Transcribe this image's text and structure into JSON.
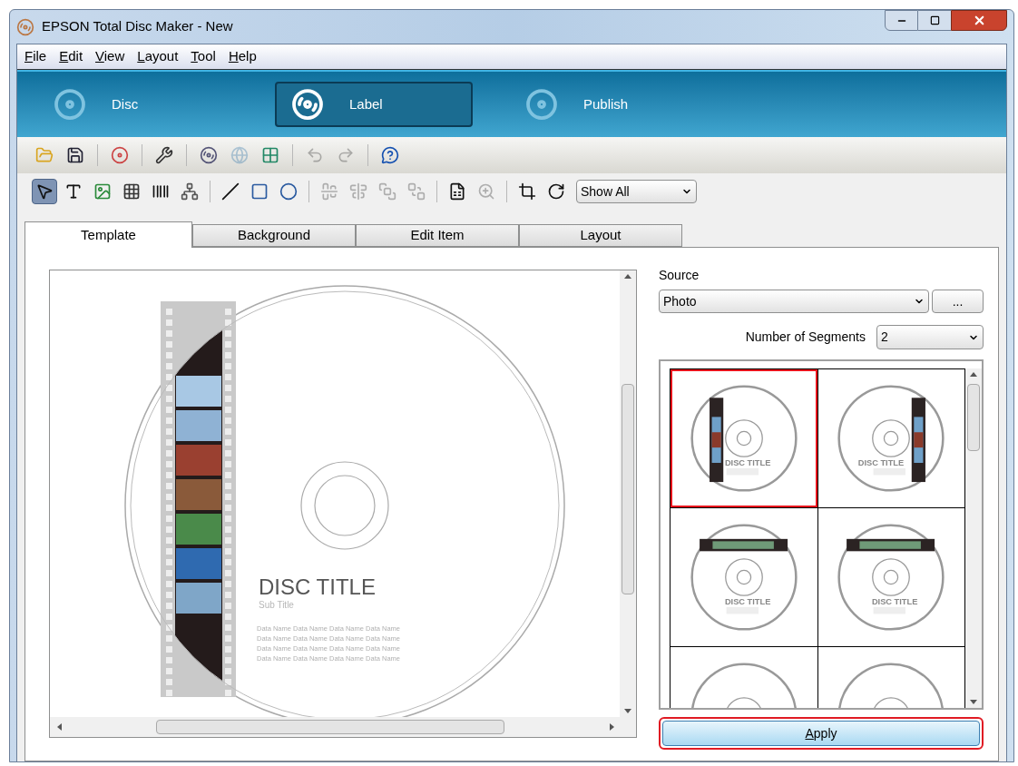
{
  "window": {
    "title": "EPSON Total Disc Maker - New"
  },
  "menu": [
    "File",
    "Edit",
    "View",
    "Layout",
    "Tool",
    "Help"
  ],
  "modes": [
    {
      "label": "Disc",
      "kind": "disc",
      "selected": false
    },
    {
      "label": "Label",
      "kind": "label",
      "selected": true
    },
    {
      "label": "Publish",
      "kind": "publish",
      "selected": false
    }
  ],
  "toolbar_1": [
    {
      "kind": "open",
      "disabled": false
    },
    {
      "kind": "save",
      "disabled": false
    },
    {
      "kind": "separator"
    },
    {
      "kind": "disc-add",
      "disabled": false
    },
    {
      "kind": "separator"
    },
    {
      "kind": "wrench",
      "disabled": false
    },
    {
      "kind": "separator"
    },
    {
      "kind": "disc-import",
      "disabled": false
    },
    {
      "kind": "globe",
      "disabled": true
    },
    {
      "kind": "grid-import",
      "disabled": false
    },
    {
      "kind": "separator"
    },
    {
      "kind": "undo",
      "disabled": true
    },
    {
      "kind": "redo",
      "disabled": true
    },
    {
      "kind": "separator"
    },
    {
      "kind": "help",
      "disabled": false
    }
  ],
  "toolbar_2": [
    {
      "kind": "pointer",
      "disabled": false,
      "selected": true
    },
    {
      "kind": "text",
      "disabled": false,
      "selected": false
    },
    {
      "kind": "image",
      "disabled": false,
      "selected": false
    },
    {
      "kind": "grid",
      "disabled": false,
      "selected": false
    },
    {
      "kind": "barcode",
      "disabled": false,
      "selected": false
    },
    {
      "kind": "tree",
      "disabled": false,
      "selected": false
    },
    {
      "kind": "separator"
    },
    {
      "kind": "line",
      "disabled": false,
      "selected": false
    },
    {
      "kind": "rectangle",
      "disabled": false,
      "selected": false
    },
    {
      "kind": "ellipse",
      "disabled": false,
      "selected": false
    },
    {
      "kind": "separator"
    },
    {
      "kind": "align-center",
      "disabled": true,
      "selected": false
    },
    {
      "kind": "align-middle",
      "disabled": true,
      "selected": false
    },
    {
      "kind": "front",
      "disabled": true,
      "selected": false
    },
    {
      "kind": "back",
      "disabled": true,
      "selected": false
    },
    {
      "kind": "separator"
    },
    {
      "kind": "csv",
      "disabled": false,
      "selected": false
    },
    {
      "kind": "zoom",
      "disabled": true,
      "selected": false
    },
    {
      "kind": "separator"
    },
    {
      "kind": "crop",
      "disabled": false,
      "selected": false
    },
    {
      "kind": "rotate",
      "disabled": false,
      "selected": false
    }
  ],
  "view_filter": {
    "value": "Show All"
  },
  "tabs": [
    {
      "label": "Template",
      "selected": true
    },
    {
      "label": "Background",
      "selected": false
    },
    {
      "label": "Edit Item",
      "selected": false
    },
    {
      "label": "Layout",
      "selected": false
    }
  ],
  "preview": {
    "title": "DISC TITLE",
    "subtitle": "Sub Title",
    "data_lines": [
      "Data Name Data Name Data Name Data Name",
      "Data Name Data Name Data Name Data Name",
      "Data Name Data Name Data Name Data Name",
      "Data Name Data Name Data Name Data Name"
    ]
  },
  "source": {
    "label": "Source",
    "value": "Photo",
    "browse": "..."
  },
  "segments": {
    "label": "Number of Segments",
    "value": "2"
  },
  "templates": [
    {
      "kind": "left",
      "title": "DISC TITLE",
      "selected": true
    },
    {
      "kind": "right",
      "title": "DISC TITLE",
      "selected": false
    },
    {
      "kind": "top",
      "title": "DISC TITLE",
      "selected": false
    },
    {
      "kind": "top",
      "title": "DISC TITLE",
      "selected": false
    },
    {
      "kind": "none",
      "selected": false
    },
    {
      "kind": "none",
      "selected": false
    }
  ],
  "apply_button": "Apply"
}
